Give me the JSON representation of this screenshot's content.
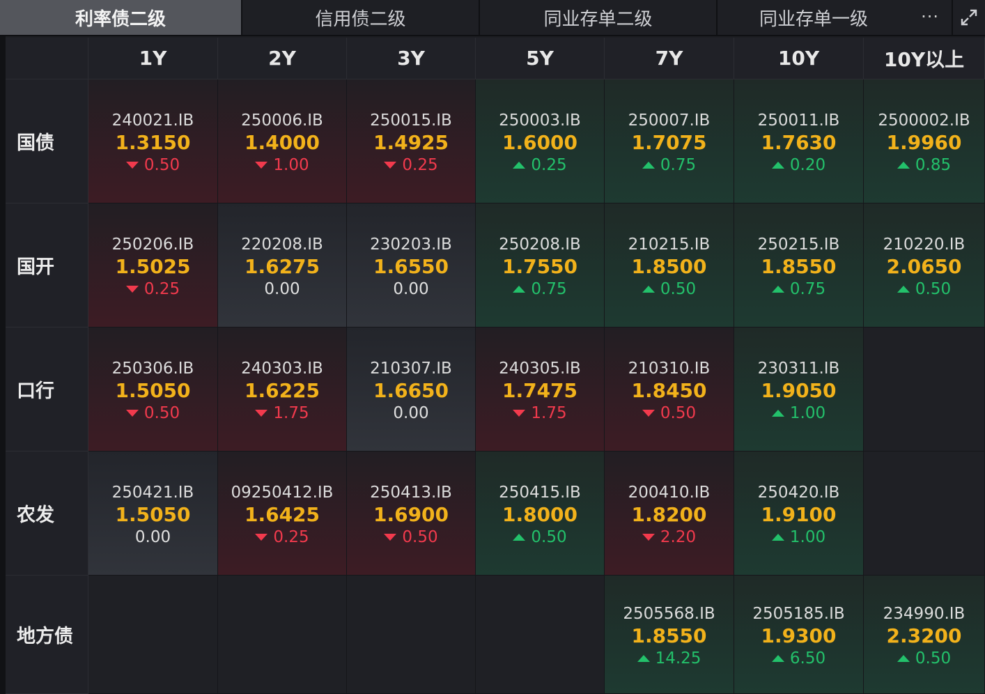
{
  "tabs": [
    {
      "label": "利率债二级",
      "active": true
    },
    {
      "label": "信用债二级",
      "active": false
    },
    {
      "label": "同业存单二级",
      "active": false
    },
    {
      "label": "同业存单一级",
      "active": false
    }
  ],
  "more_label": "···",
  "columns": [
    "1Y",
    "2Y",
    "3Y",
    "5Y",
    "7Y",
    "10Y",
    "10Y以上"
  ],
  "rows": [
    {
      "label": "国债",
      "cells": [
        {
          "code": "240021.IB",
          "yield": "1.3150",
          "change": "0.50",
          "dir": "down"
        },
        {
          "code": "250006.IB",
          "yield": "1.4000",
          "change": "1.00",
          "dir": "down"
        },
        {
          "code": "250015.IB",
          "yield": "1.4925",
          "change": "0.25",
          "dir": "down"
        },
        {
          "code": "250003.IB",
          "yield": "1.6000",
          "change": "0.25",
          "dir": "up"
        },
        {
          "code": "250007.IB",
          "yield": "1.7075",
          "change": "0.75",
          "dir": "up"
        },
        {
          "code": "250011.IB",
          "yield": "1.7630",
          "change": "0.20",
          "dir": "up"
        },
        {
          "code": "2500002.IB",
          "yield": "1.9960",
          "change": "0.85",
          "dir": "up"
        }
      ]
    },
    {
      "label": "国开",
      "cells": [
        {
          "code": "250206.IB",
          "yield": "1.5025",
          "change": "0.25",
          "dir": "down"
        },
        {
          "code": "220208.IB",
          "yield": "1.6275",
          "change": "0.00",
          "dir": "flat"
        },
        {
          "code": "230203.IB",
          "yield": "1.6550",
          "change": "0.00",
          "dir": "flat"
        },
        {
          "code": "250208.IB",
          "yield": "1.7550",
          "change": "0.75",
          "dir": "up"
        },
        {
          "code": "210215.IB",
          "yield": "1.8500",
          "change": "0.50",
          "dir": "up"
        },
        {
          "code": "250215.IB",
          "yield": "1.8550",
          "change": "0.75",
          "dir": "up"
        },
        {
          "code": "210220.IB",
          "yield": "2.0650",
          "change": "0.50",
          "dir": "up"
        }
      ]
    },
    {
      "label": "口行",
      "cells": [
        {
          "code": "250306.IB",
          "yield": "1.5050",
          "change": "0.50",
          "dir": "down"
        },
        {
          "code": "240303.IB",
          "yield": "1.6225",
          "change": "1.75",
          "dir": "down"
        },
        {
          "code": "210307.IB",
          "yield": "1.6650",
          "change": "0.00",
          "dir": "flat"
        },
        {
          "code": "240305.IB",
          "yield": "1.7475",
          "change": "1.75",
          "dir": "down"
        },
        {
          "code": "210310.IB",
          "yield": "1.8450",
          "change": "0.50",
          "dir": "down"
        },
        {
          "code": "230311.IB",
          "yield": "1.9050",
          "change": "1.00",
          "dir": "up"
        },
        null
      ]
    },
    {
      "label": "农发",
      "cells": [
        {
          "code": "250421.IB",
          "yield": "1.5050",
          "change": "0.00",
          "dir": "flat"
        },
        {
          "code": "09250412.IB",
          "yield": "1.6425",
          "change": "0.25",
          "dir": "down"
        },
        {
          "code": "250413.IB",
          "yield": "1.6900",
          "change": "0.50",
          "dir": "down"
        },
        {
          "code": "250415.IB",
          "yield": "1.8000",
          "change": "0.50",
          "dir": "up"
        },
        {
          "code": "200410.IB",
          "yield": "1.8200",
          "change": "2.20",
          "dir": "down"
        },
        {
          "code": "250420.IB",
          "yield": "1.9100",
          "change": "1.00",
          "dir": "up"
        },
        null
      ]
    },
    {
      "label": "地方债",
      "cells": [
        null,
        null,
        null,
        null,
        {
          "code": "2505568.IB",
          "yield": "1.8550",
          "change": "14.25",
          "dir": "up"
        },
        {
          "code": "2505185.IB",
          "yield": "1.9300",
          "change": "6.50",
          "dir": "up"
        },
        {
          "code": "234990.IB",
          "yield": "2.3200",
          "change": "0.50",
          "dir": "up"
        }
      ]
    }
  ],
  "colors": {
    "up": "#23c16b",
    "down": "#f23a4d",
    "yield": "#f2b21b",
    "active_tab": "#54565c"
  },
  "icons": {
    "more": "more-dots-icon",
    "expand": "expand-icon"
  }
}
